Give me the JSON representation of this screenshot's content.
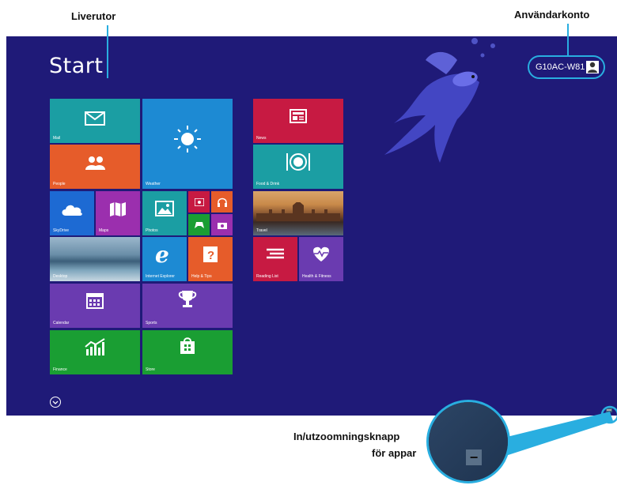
{
  "callouts": {
    "live_tiles": "Liverutor",
    "user_account": "Användarkonto",
    "zoom_line1": "In/utzoomningsknapp",
    "zoom_line2": "för appar"
  },
  "start": {
    "title": "Start",
    "user_name": "G10AC-W81"
  },
  "tiles": {
    "mail": "Mail",
    "people": "People",
    "weather": "Weather",
    "skydrive": "SkyDrive",
    "maps": "Maps",
    "photos": "Photos",
    "desktop": "Desktop",
    "ie": "Internet Explorer",
    "help": "Help & Tips",
    "calendar": "Calendar",
    "sports": "Sports",
    "finance": "Finance",
    "store": "Store",
    "news": "News",
    "food": "Food & Drink",
    "travel": "Travel",
    "reading": "Reading List",
    "health": "Health & Fitness"
  },
  "zoom_button": {
    "symbol": "−"
  },
  "colors": {
    "start_bg": "#1f1a78",
    "callout_line": "#29aee0",
    "teal": "#1b9ea3",
    "orange": "#e65c2a",
    "blue": "#1d8ad3",
    "purple": "#6a3bb0",
    "red": "#c71a42",
    "green": "#1a9e33"
  }
}
